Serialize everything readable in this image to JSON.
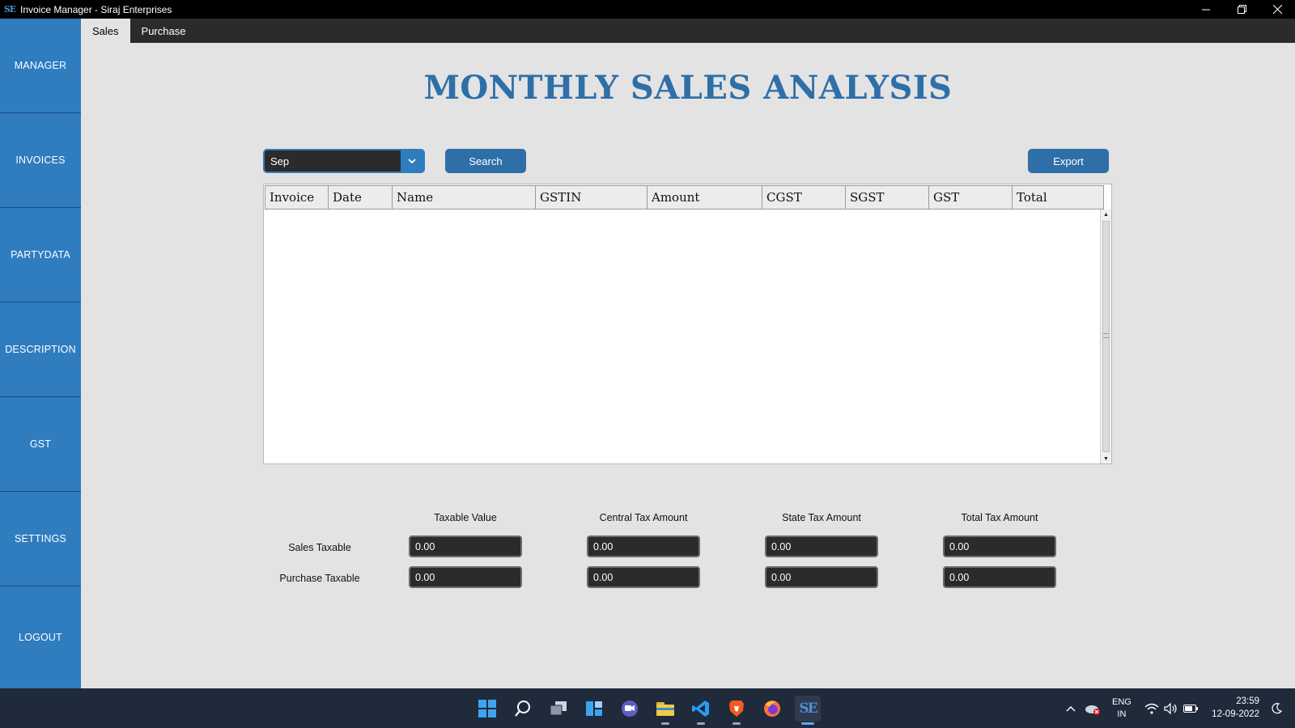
{
  "window": {
    "title": "Invoice Manager - Siraj Enterprises",
    "logo_text": "SE"
  },
  "sidebar": {
    "items": [
      {
        "label": "MANAGER"
      },
      {
        "label": "INVOICES"
      },
      {
        "label": "PARTYDATA"
      },
      {
        "label": "DESCRIPTION"
      },
      {
        "label": "GST"
      },
      {
        "label": "SETTINGS"
      },
      {
        "label": "LOGOUT"
      }
    ]
  },
  "tabs": [
    {
      "label": "Sales",
      "active": true
    },
    {
      "label": "Purchase",
      "active": false
    }
  ],
  "main": {
    "title": "MONTHLY SALES ANALYSIS",
    "month_select": {
      "value": "Sep"
    },
    "search_label": "Search",
    "export_label": "Export",
    "table": {
      "columns": [
        "Invoice",
        "Date",
        "Name",
        "GSTIN",
        "Amount",
        "CGST",
        "SGST",
        "GST",
        "Total"
      ],
      "rows": []
    },
    "summary": {
      "columns": [
        "Taxable Value",
        "Central Tax Amount",
        "State Tax Amount",
        "Total Tax Amount"
      ],
      "rows": [
        {
          "label": "Sales Taxable",
          "values": [
            "0.00",
            "0.00",
            "0.00",
            "0.00"
          ]
        },
        {
          "label": "Purchase Taxable",
          "values": [
            "0.00",
            "0.00",
            "0.00",
            "0.00"
          ]
        }
      ]
    }
  },
  "taskbar": {
    "icons": [
      "windows-start-icon",
      "search-icon",
      "task-view-icon",
      "widgets-icon",
      "chat-icon",
      "file-explorer-icon",
      "vscode-icon",
      "brave-icon",
      "firefox-icon",
      "invoice-manager-icon"
    ],
    "language": {
      "line1": "ENG",
      "line2": "IN"
    },
    "time": "23:59",
    "date": "12-09-2022"
  },
  "colors": {
    "sidebar": "#2f7cbf",
    "accent": "#2f6fa8",
    "field_bg": "#2b2b2b",
    "main_bg": "#e3e3e3"
  }
}
